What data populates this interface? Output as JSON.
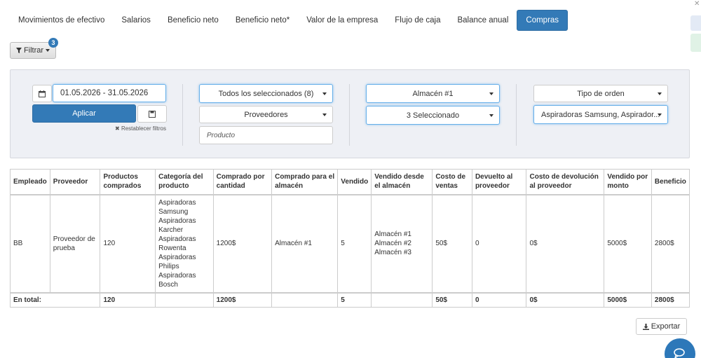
{
  "tabs": [
    {
      "label": "Movimientos de efectivo"
    },
    {
      "label": "Salarios"
    },
    {
      "label": "Beneficio neto"
    },
    {
      "label": "Beneficio neto*"
    },
    {
      "label": "Valor de la empresa"
    },
    {
      "label": "Flujo de caja"
    },
    {
      "label": "Balance anual"
    },
    {
      "label": "Compras",
      "active": true
    }
  ],
  "filter": {
    "label": "Filtrar",
    "badge": "3"
  },
  "filters": {
    "date_range": "01.05.2026 - 31.05.2026",
    "apply_label": "Aplicar",
    "reset_label": "Restablecer filtros",
    "employees_select": "Todos los seleccionados (8)",
    "providers_select": "Proveedores",
    "product_placeholder": "Producto",
    "warehouse_select": "Almacén #1",
    "categories_select": "3 Seleccionado",
    "order_type_select": "Tipo de orden",
    "products_select": "Aspiradoras Samsung, Aspirador..."
  },
  "table": {
    "headers": [
      "Empleado",
      "Proveedor",
      "Productos comprados",
      "Categoría del producto",
      "Comprado por cantidad",
      "Comprado para el almacén",
      "Vendido",
      "Vendido desde el almacén",
      "Costo de ventas",
      "Devuelto al proveedor",
      "Costo de devolución al proveedor",
      "Vendido por monto",
      "Beneficio"
    ],
    "row": {
      "employee": "BB",
      "provider": "Proveedor de prueba",
      "products_bought": "120",
      "categories": [
        "Aspiradoras",
        "Samsung",
        "Aspiradoras",
        "Karcher",
        "Aspiradoras",
        "Rowenta",
        "Aspiradoras",
        "Philips",
        "Aspiradoras",
        "Bosch"
      ],
      "bought_amount": "1200$",
      "bought_for_warehouse": "Almacén #1",
      "sold": "5",
      "sold_from_warehouses": [
        "Almacén #1",
        "Almacén #2",
        "Almacén #3"
      ],
      "cost_of_sales": "50$",
      "returned": "0",
      "return_cost": "0$",
      "sold_amount": "5000$",
      "profit": "2800$"
    },
    "totals": {
      "label": "En total:",
      "products_bought": "120",
      "bought_amount": "1200$",
      "sold": "5",
      "cost_of_sales": "50$",
      "returned": "0",
      "return_cost": "0$",
      "sold_amount": "5000$",
      "profit": "2800$"
    }
  },
  "export_label": "Exportar",
  "colors": {
    "primary": "#337ab7",
    "panel_bg": "#eef0f5",
    "focus": "#66afe9"
  }
}
